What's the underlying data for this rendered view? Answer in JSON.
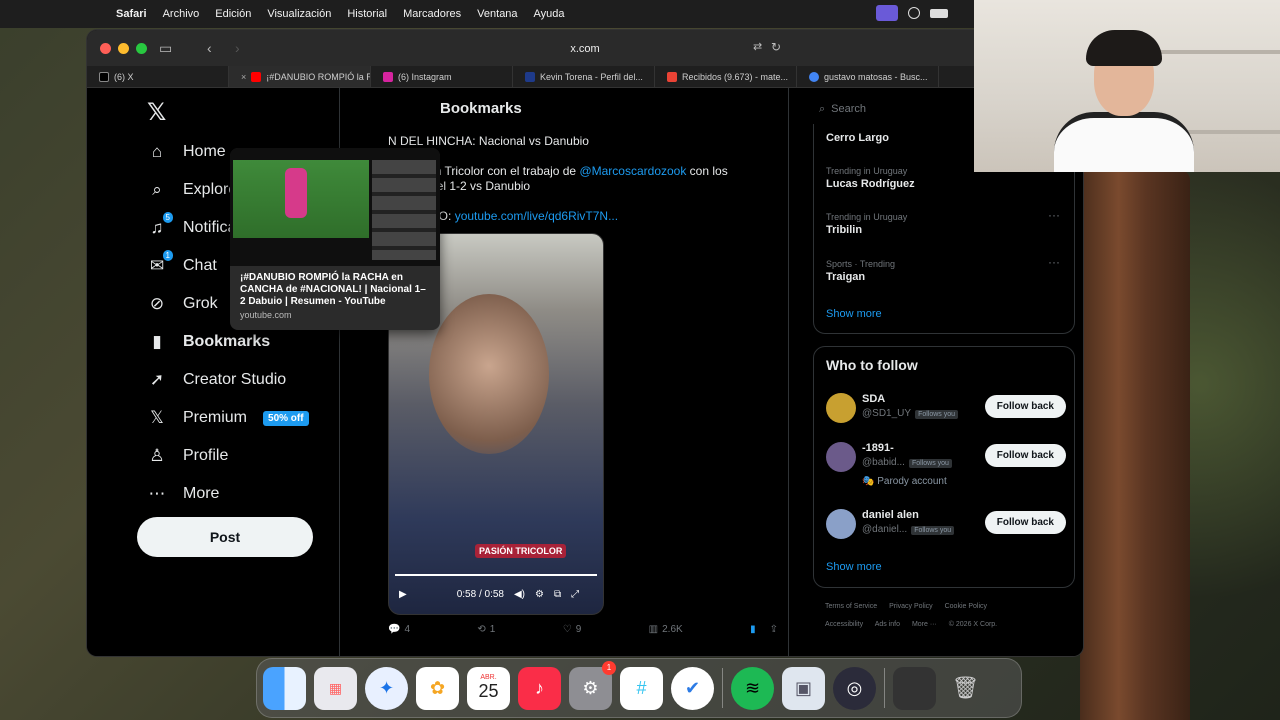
{
  "menubar": {
    "app_name": "Safari",
    "items": [
      "Archivo",
      "Edición",
      "Visualización",
      "Historial",
      "Marcadores",
      "Ventana",
      "Ayuda"
    ]
  },
  "browser": {
    "address": "x.com",
    "tabs": [
      {
        "label": "(6) X",
        "icon": "x-icon",
        "color": "#000000"
      },
      {
        "label": "¡#DANUBIO ROMPIÓ la R...",
        "icon": "youtube-icon",
        "color": "#ff0000"
      },
      {
        "label": "(6) Instagram",
        "icon": "instagram-icon",
        "color": "#d6249f"
      },
      {
        "label": "Kevin Torena - Perfil del...",
        "icon": "site-icon",
        "color": "#1e3a8a"
      },
      {
        "label": "Recibidos (9.673) - mate...",
        "icon": "gmail-icon",
        "color": "#ea4335"
      },
      {
        "label": "gustavo matosas - Busc...",
        "icon": "google-icon",
        "color": "#4285f4"
      }
    ]
  },
  "tab_preview": {
    "title": "¡#DANUBIO ROMPIÓ la RACHA en CANCHA de #NACIONAL! | Nacional 1–2 Dabuio | Resumen - YouTube",
    "url": "youtube.com"
  },
  "nav": {
    "items": [
      {
        "label": "Home",
        "icon": "home-icon"
      },
      {
        "label": "Explore",
        "icon": "search-icon"
      },
      {
        "label": "Notifications",
        "icon": "bell-icon",
        "badge": "5"
      },
      {
        "label": "Chat",
        "icon": "chat-icon",
        "badge": "1"
      },
      {
        "label": "Grok",
        "icon": "grok-icon"
      },
      {
        "label": "Bookmarks",
        "icon": "bookmark-icon"
      },
      {
        "label": "Creator Studio",
        "icon": "rocket-icon"
      },
      {
        "label": "Premium",
        "icon": "x-icon",
        "promo": "50% off"
      },
      {
        "label": "Profile",
        "icon": "person-icon"
      },
      {
        "label": "More",
        "icon": "more-icon"
      }
    ],
    "post_label": "Post"
  },
  "main": {
    "title": "Bookmarks",
    "line1": "N DEL HINCHA: Nacional vs Danubio",
    "line2_pre": "de Pasión Tricolor con el trabajo de ",
    "line2_link": "@Marcoscardozook",
    "line2_post": " con los",
    "line3": "espués del 1-2 vs Danubio",
    "line4_pre": "S EN VIVO: ",
    "line4_link": "youtube.com/live/qd6RivT7N...",
    "video_overlay": "PASIÓN TRICOLOR",
    "video_time": "0:58 / 0:58",
    "actions": {
      "replies": "4",
      "reposts": "1",
      "likes": "9",
      "views": "2.6K"
    }
  },
  "right": {
    "search_placeholder": "Search",
    "trends": [
      {
        "context": "",
        "name": "Cerro Largo"
      },
      {
        "context": "Trending in Uruguay",
        "name": "Lucas Rodríguez"
      },
      {
        "context": "Trending in Uruguay",
        "name": "Tribilin"
      },
      {
        "context": "Sports · Trending",
        "name": "Traigan"
      }
    ],
    "show_more": "Show more",
    "who_to_follow": "Who to follow",
    "accounts": [
      {
        "name": "SDA",
        "handle": "@SD1_UY",
        "follows_you": "Follows you",
        "extra": "",
        "button": "Follow back",
        "color": "#c8a030"
      },
      {
        "name": "-1891-",
        "handle": "@babid...",
        "follows_you": "Follows you",
        "extra": "🎭 Parody account",
        "button": "Follow back",
        "color": "#6b5a8a"
      },
      {
        "name": "daniel alen",
        "handle": "@daniel...",
        "follows_you": "Follows you",
        "extra": "",
        "button": "Follow back",
        "color": "#8aa0c8"
      }
    ],
    "footer": [
      "Terms of Service",
      "Privacy Policy",
      "Cookie Policy",
      "Accessibility",
      "Ads info",
      "More ···",
      "© 2026 X Corp."
    ]
  },
  "dock": {
    "calendar_month": "ABR.",
    "calendar_day": "25",
    "settings_badge": "1",
    "apps": [
      "finder-icon",
      "launchpad-icon",
      "safari-icon",
      "photos-icon",
      "calendar-icon",
      "music-icon",
      "settings-icon",
      "slack-icon",
      "ticktick-icon",
      "spotify-icon",
      "preview-icon",
      "obs-icon",
      "trash-icon"
    ]
  }
}
